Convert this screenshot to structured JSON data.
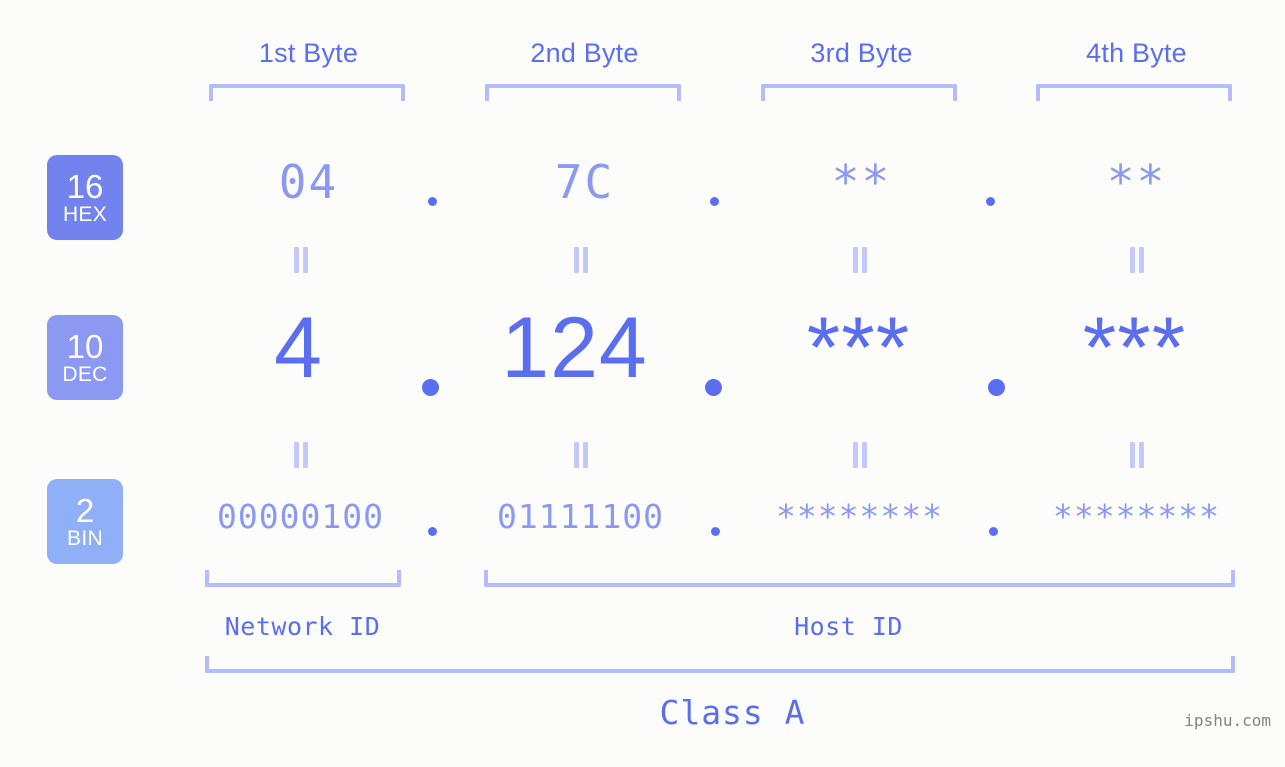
{
  "page": {
    "background": "#fcfdfa",
    "accent_strong": "#5b6ef0",
    "accent_mid": "#8b99f2",
    "accent_light": "#b4bdfb"
  },
  "columns": [
    {
      "label": "1st Byte"
    },
    {
      "label": "2nd Byte"
    },
    {
      "label": "3rd Byte"
    },
    {
      "label": "4th Byte"
    }
  ],
  "rows": [
    {
      "badge_number": "16",
      "badge_system": "HEX",
      "badge_color": "#7383ee",
      "values": [
        "04",
        "7C",
        "**",
        "**"
      ]
    },
    {
      "badge_number": "10",
      "badge_system": "DEC",
      "badge_color": "#8b99f2",
      "values": [
        "4",
        "124",
        "***",
        "***"
      ]
    },
    {
      "badge_number": "2",
      "badge_system": "BIN",
      "badge_color": "#8fb0f6",
      "values": [
        "00000100",
        "01111100",
        "********",
        "********"
      ]
    }
  ],
  "separators": {
    "dot": ".",
    "equals": "="
  },
  "segments": {
    "network_id": "Network ID",
    "host_id": "Host ID"
  },
  "class": {
    "label": "Class A"
  },
  "watermark": {
    "text": "ipshu.com"
  }
}
